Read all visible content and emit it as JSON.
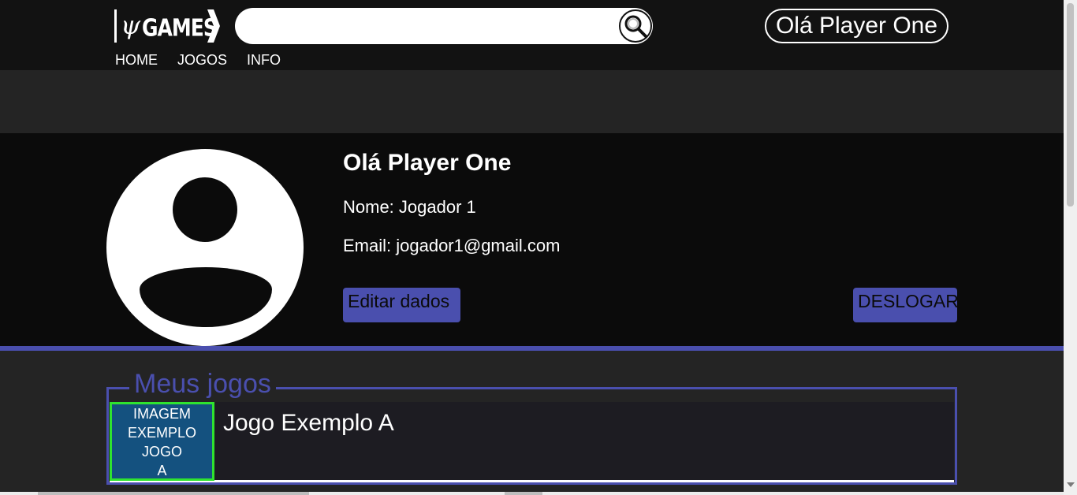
{
  "header": {
    "logo_symbol": "ψ",
    "logo_text": "GAMES",
    "search": {
      "value": "",
      "placeholder": ""
    },
    "greeting": "Olá Player One",
    "nav": {
      "home": "HOME",
      "games": "JOGOS",
      "info": "INFO"
    }
  },
  "profile": {
    "title": "Olá Player One",
    "name_line": "Nome: Jogador 1",
    "email_line": "Email: jogador1@gmail.com",
    "edit_button": "Editar dados",
    "logout_button": "DESLOGAR"
  },
  "my_games": {
    "legend": "Meus jogos",
    "items": [
      {
        "thumb_lines": [
          "IMAGEM",
          "EXEMPLO",
          "JOGO",
          "A"
        ],
        "name": "Jogo Exemplo A"
      }
    ]
  },
  "colors": {
    "accent": "#4a4fae",
    "thumb_bg": "#14517f",
    "thumb_border": "#2fe32f",
    "header_bg": "#121212",
    "profile_bg": "#0b0b0b"
  }
}
